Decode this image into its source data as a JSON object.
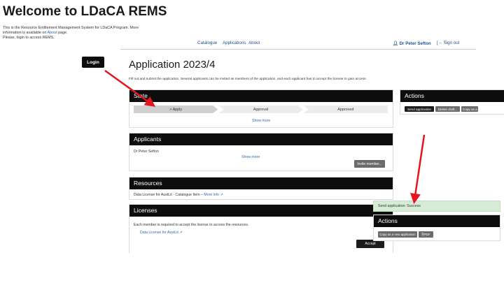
{
  "page": {
    "welcome_title": "Welcome to LDaCA REMS",
    "intro_line1": "This is the Resource Entitlement Management System for LDaCA Program. More",
    "intro_line2_prefix": "information is available on ",
    "intro_about_link": "About",
    "intro_line2_suffix": " page.",
    "intro_line3": "Please, login to access REMS.",
    "login_label": "Login"
  },
  "nav": {
    "catalogue": "Catalogue",
    "applications": "Applications",
    "about": "About",
    "user": "Dr Peter Sefton",
    "signout": "Sign out"
  },
  "application": {
    "title": "Application 2023/4",
    "description": "Fill out and submit the application. Several applicants can be invited as members of the application, and each applicant has to accept the license to gain access.",
    "state": {
      "heading": "State",
      "steps": [
        "> Apply",
        "Approval",
        "Approved"
      ],
      "show_more": "Show more"
    },
    "applicants": {
      "heading": "Applicants",
      "member": "Dr Peter Sefton",
      "show_more": "Show more",
      "invite_label": "Invite member..."
    },
    "resources": {
      "heading": "Resources",
      "item": "Data License for AustLit - Catalogue Item – ",
      "more_info": "More info"
    },
    "licenses": {
      "heading": "Licenses",
      "description": "Each member is required to accept the license to access the resources.",
      "license_link": "Data License for AustLit",
      "accept_label": "Accept"
    }
  },
  "actions": {
    "heading": "Actions",
    "send_application": "Send application",
    "delete_draft": "Delete draft...",
    "copy_new_truncated": "Copy as a"
  },
  "popup": {
    "toast": "Send application: Success",
    "heading": "Actions",
    "copy_new": "Copy as a new application",
    "pdf": "PDF"
  },
  "colors": {
    "arrow": "#e8141c",
    "header_black": "#0d0d0d",
    "link_blue": "#2b6cb0",
    "success_green": "#d7ecd7"
  }
}
